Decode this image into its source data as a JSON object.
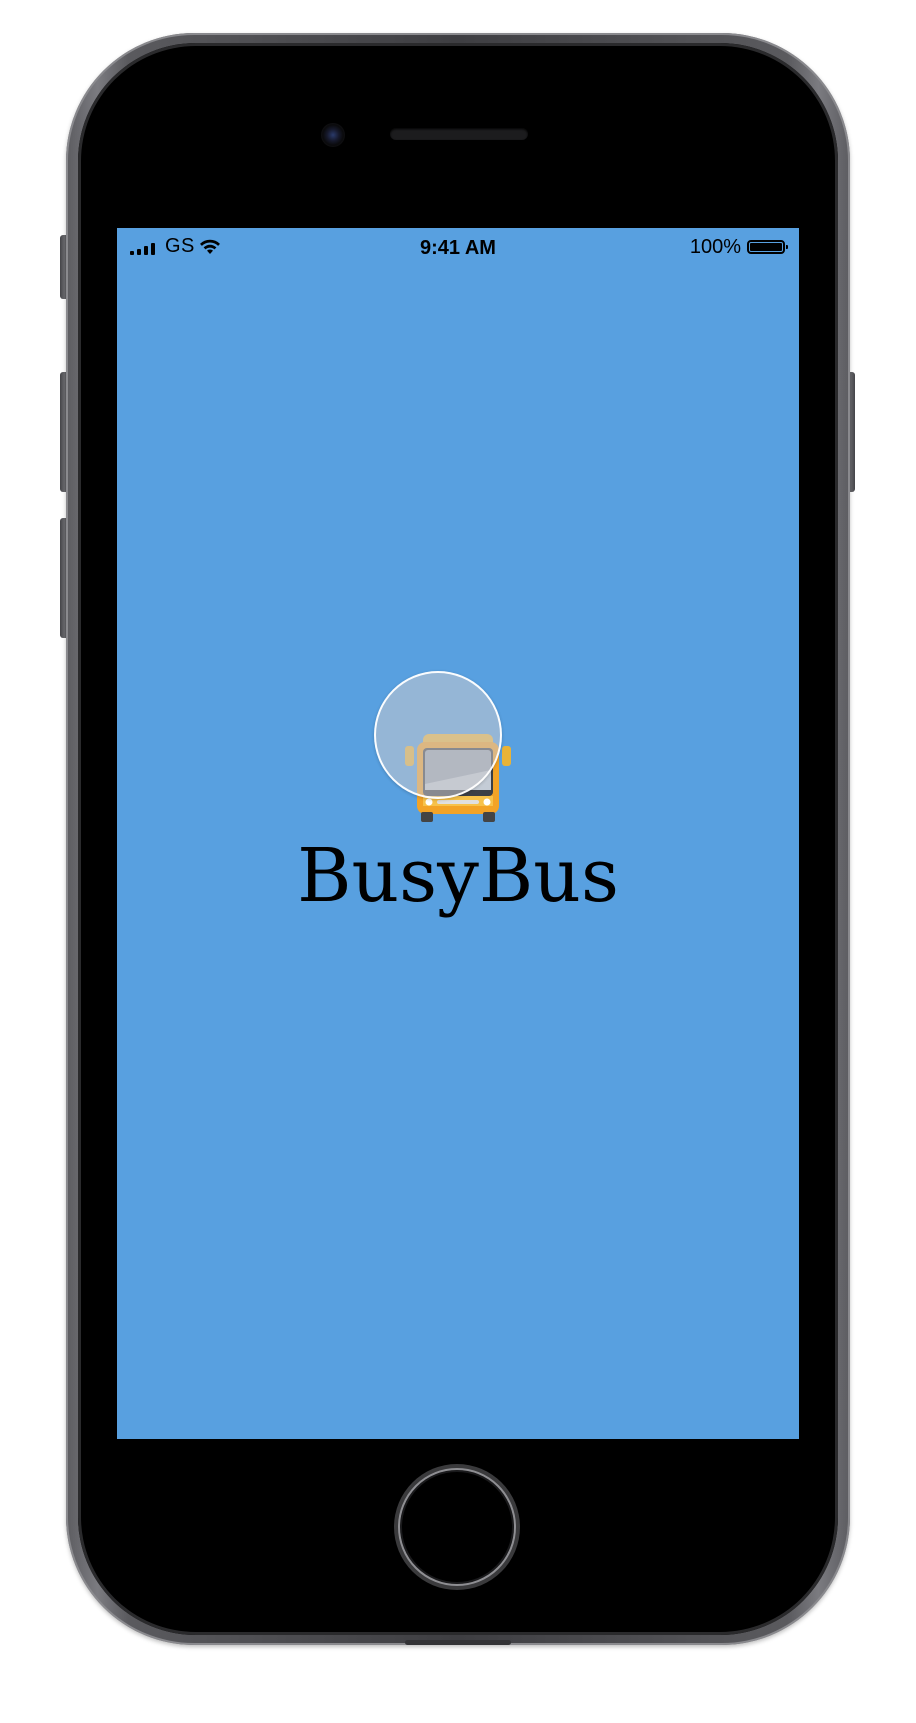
{
  "status_bar": {
    "carrier": "GS",
    "time": "9:41 AM",
    "battery_percent": "100%",
    "icons": [
      "signal-icon",
      "wifi-icon",
      "battery-icon"
    ]
  },
  "splash": {
    "app_name": "BusyBus",
    "logo": "bus-icon",
    "background_color": "#58a0e0"
  },
  "device": {
    "model": "iPhone",
    "color": "space-gray"
  }
}
